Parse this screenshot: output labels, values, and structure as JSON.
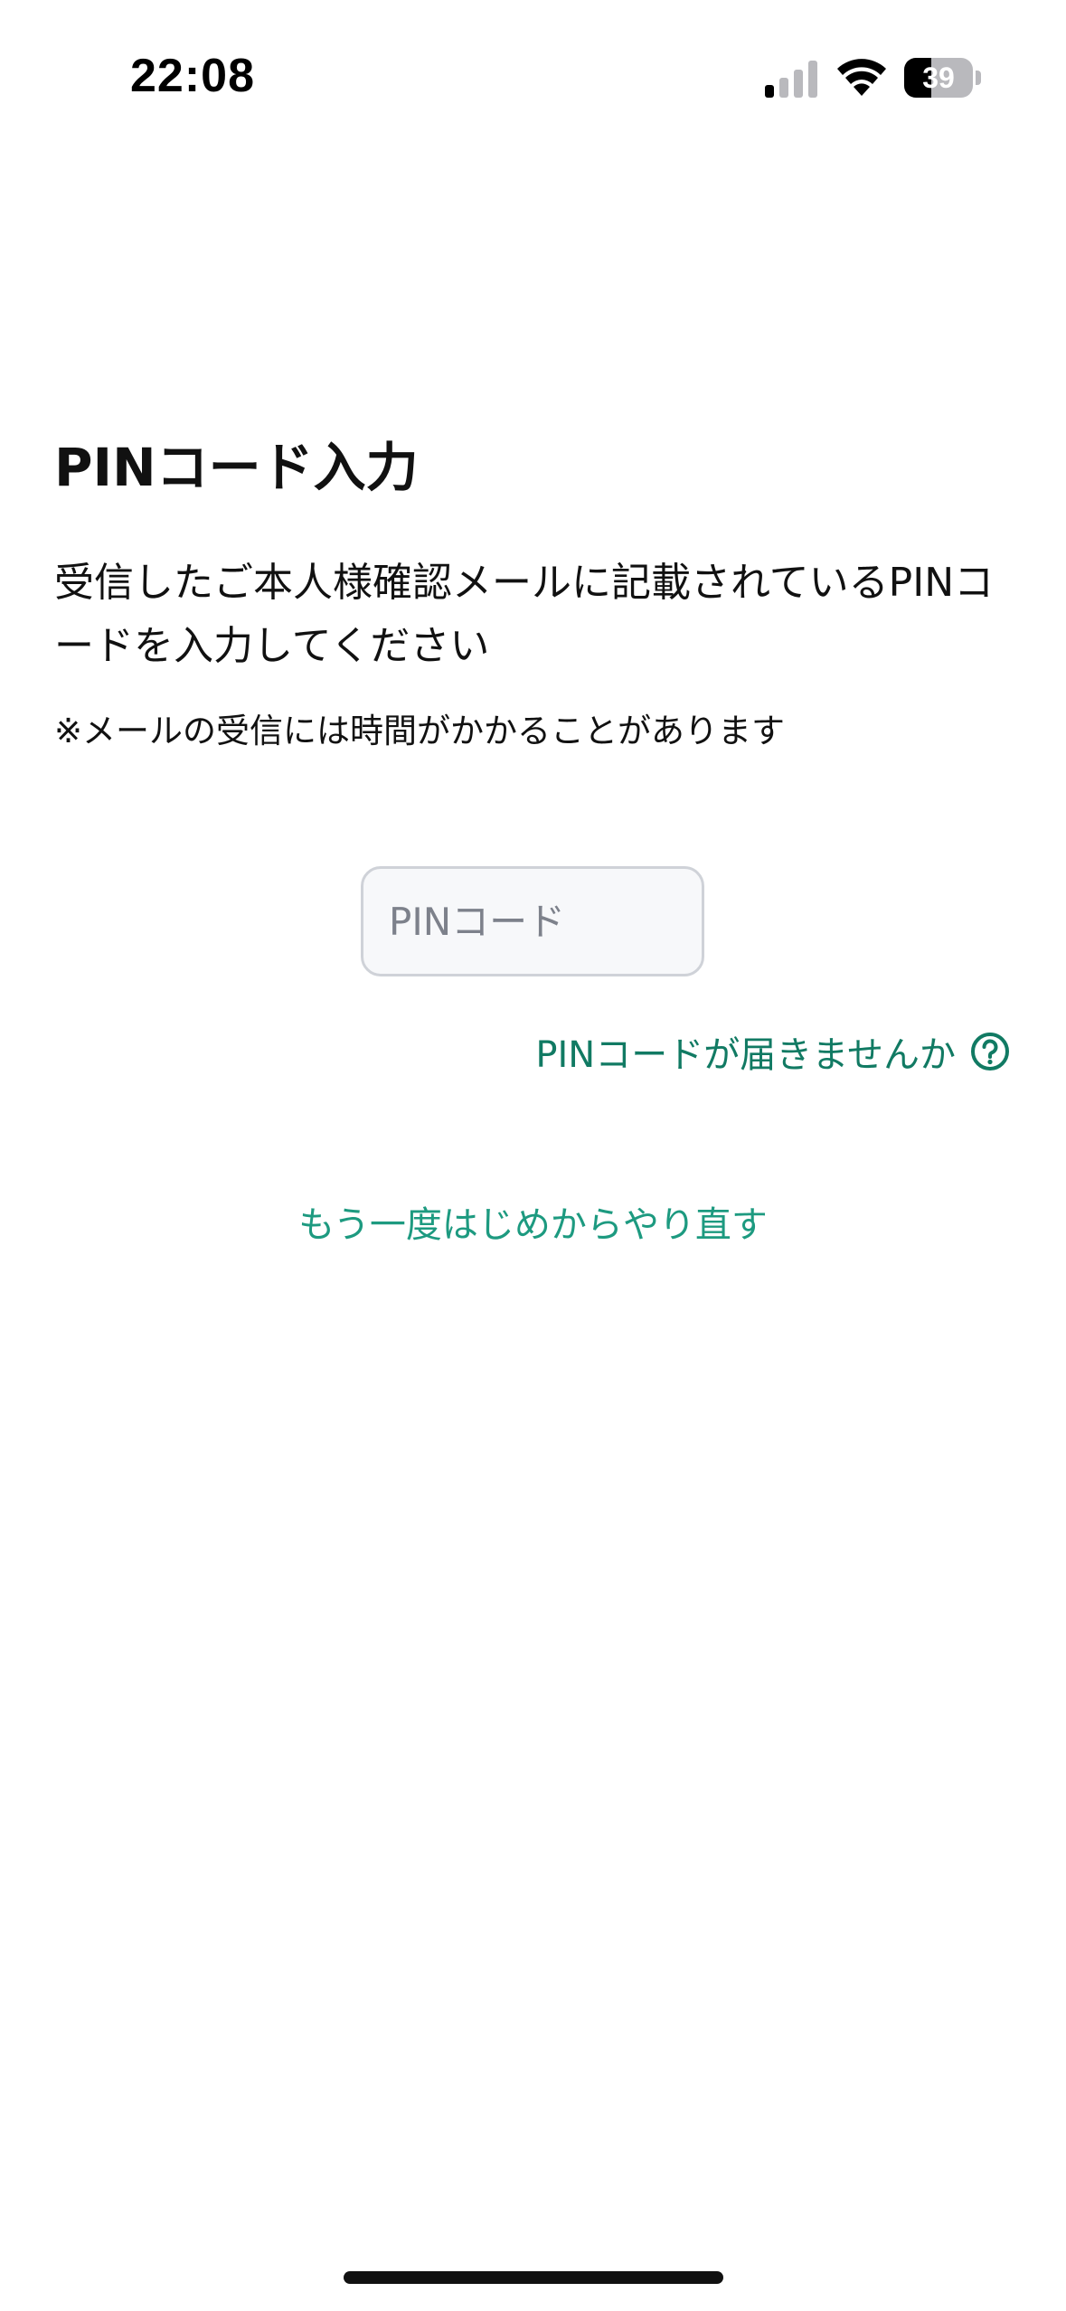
{
  "status_bar": {
    "time": "22:08",
    "battery_level": 39,
    "battery_text": "39",
    "signal_bars_active": 1,
    "signal_bars_total": 4,
    "icons": [
      "signal-icon",
      "wifi-icon",
      "battery-icon"
    ]
  },
  "screen": {
    "title": "PINコード入力",
    "instruction": "受信したご本人様確認メールに記載されているPINコードを入力してください",
    "note": "※メールの受信には時間がかかることがあります",
    "pin_input": {
      "value": "",
      "placeholder": "PINコード"
    },
    "pin_help": {
      "label": "PINコードが届きませんか",
      "icon": "question-circle-icon"
    },
    "restart_link": "もう一度はじめからやり直す"
  },
  "colors": {
    "accent_dark": "#117a63",
    "accent": "#1d9a80",
    "input_border": "#cfd2d8",
    "input_background": "#f7f8fa"
  }
}
